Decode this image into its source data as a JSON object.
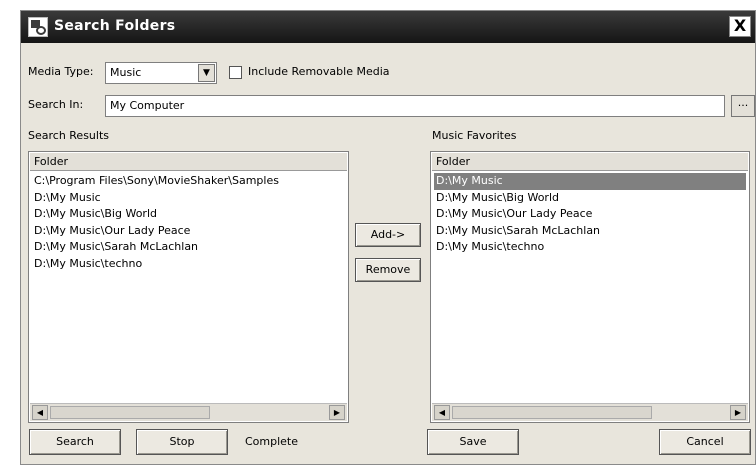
{
  "window": {
    "title": "Search Folders",
    "close_glyph": "X"
  },
  "media_type": {
    "label": "Media Type:",
    "value": "Music"
  },
  "removable": {
    "label": "Include Removable Media",
    "checked": false
  },
  "search_in": {
    "label": "Search In:",
    "value": "My Computer",
    "browse_label": "..."
  },
  "results": {
    "heading": "Search Results",
    "column": "Folder",
    "items": [
      "C:\\Program Files\\Sony\\MovieShaker\\Samples",
      "D:\\My Music",
      "D:\\My Music\\Big World",
      "D:\\My Music\\Our Lady Peace",
      "D:\\My Music\\Sarah McLachlan",
      "D:\\My Music\\techno"
    ]
  },
  "favorites": {
    "heading": "Music Favorites",
    "column": "Folder",
    "items": [
      "D:\\My Music",
      "D:\\My Music\\Big World",
      "D:\\My Music\\Our Lady Peace",
      "D:\\My Music\\Sarah McLachlan",
      "D:\\My Music\\techno"
    ],
    "selected_item": "D:\\My Music"
  },
  "buttons": {
    "add": "Add->",
    "remove": "Remove",
    "search": "Search",
    "stop": "Stop",
    "save": "Save",
    "cancel": "Cancel"
  },
  "status": "Complete",
  "icons": {
    "window": "search-folders-icon",
    "dropdown": "dropdown-arrow-icon",
    "scroll_left": "scroll-left-arrow-icon",
    "scroll_right": "scroll-right-arrow-icon"
  },
  "colors": {
    "titlebar": "#1e1e1e",
    "dialog": "#e8e5dc",
    "selection": "#808080"
  }
}
